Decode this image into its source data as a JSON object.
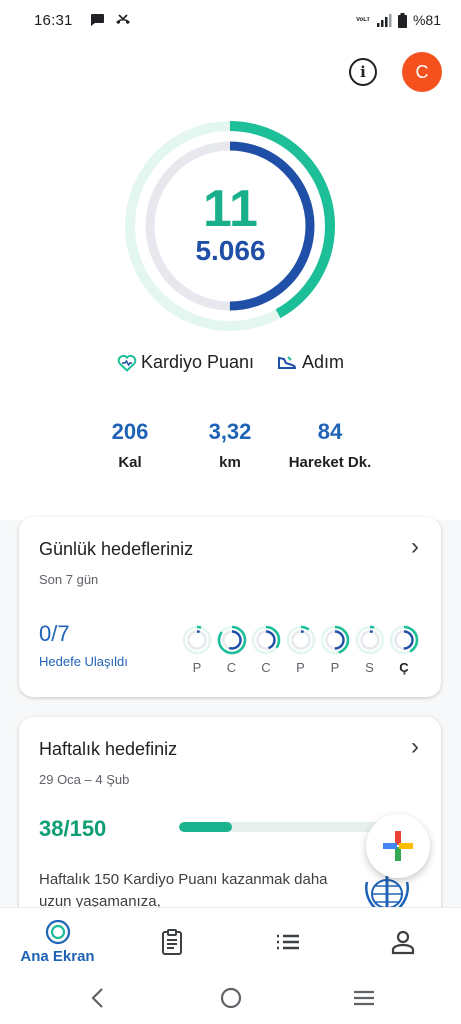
{
  "status_bar": {
    "time": "16:31",
    "network": "VoLTE",
    "battery": "%81"
  },
  "header": {
    "avatar_initial": "C"
  },
  "rings": {
    "heart_points": "11",
    "steps": "5.066",
    "heart_points_progress": 0.42,
    "steps_progress": 0.5,
    "colors": {
      "heart": "#1dbf98",
      "steps": "#1f4fa6"
    }
  },
  "legend": {
    "heart_points_label": "Kardiyo Puanı",
    "steps_label": "Adım"
  },
  "stats": [
    {
      "value": "206",
      "label": "Kal"
    },
    {
      "value": "3,32",
      "label": "km"
    },
    {
      "value": "84",
      "label": "Hareket Dk."
    }
  ],
  "daily_goals": {
    "title": "Günlük hedefleriniz",
    "subtitle": "Son 7 gün",
    "achieved": "0/7",
    "achieved_label": "Hedefe Ulaşıldı",
    "days": [
      {
        "letter": "P",
        "steps_progress": 0.05,
        "heart_progress": 0.05
      },
      {
        "letter": "C",
        "steps_progress": 0.55,
        "heart_progress": 0.85
      },
      {
        "letter": "C",
        "steps_progress": 0.45,
        "heart_progress": 0.35
      },
      {
        "letter": "P",
        "steps_progress": 0.05,
        "heart_progress": 0.1
      },
      {
        "letter": "P",
        "steps_progress": 0.5,
        "heart_progress": 0.45
      },
      {
        "letter": "S",
        "steps_progress": 0.05,
        "heart_progress": 0.05
      },
      {
        "letter": "Ç",
        "steps_progress": 0.5,
        "heart_progress": 0.42
      }
    ]
  },
  "weekly_goal": {
    "title": "Haftalık hedefiniz",
    "date_range": "29 Oca – 4 Şub",
    "progress": "38/150",
    "progress_fraction": 0.253,
    "description": "Haftalık 150 Kardiyo Puanı kazanmak daha uzun yaşamanıza,"
  },
  "bottom_nav": {
    "home_label": "Ana Ekran",
    "items": [
      "home-icon",
      "journal-icon",
      "browse-icon",
      "profile-icon"
    ]
  }
}
